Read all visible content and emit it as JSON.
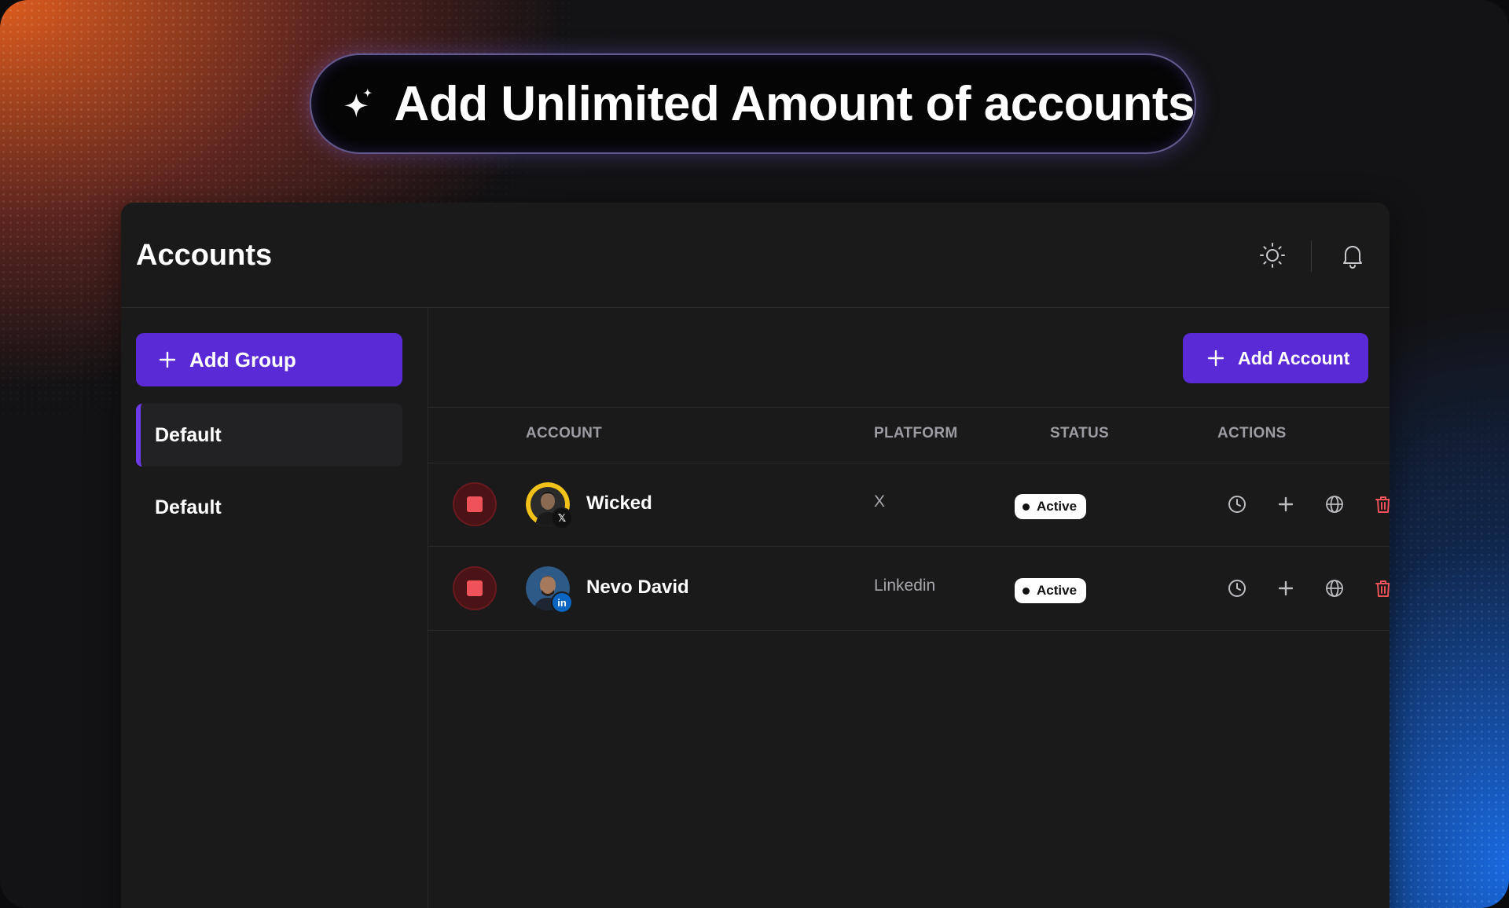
{
  "banner": {
    "title": "Add Unlimited Amount of accounts"
  },
  "header": {
    "title": "Accounts"
  },
  "sidebar": {
    "add_group_label": "Add Group",
    "groups": [
      {
        "label": "Default",
        "selected": true
      },
      {
        "label": "Default",
        "selected": false
      }
    ]
  },
  "main": {
    "add_account_label": "Add Account",
    "columns": [
      "ACCOUNT",
      "PLATFORM",
      "STATUS",
      "ACTIONS"
    ],
    "rows": [
      {
        "name": "Wicked",
        "platform": "X",
        "status": "Active",
        "badge": "x-icon"
      },
      {
        "name": "Nevo David",
        "platform": "Linkedin",
        "status": "Active",
        "badge": "linkedin-icon"
      }
    ]
  },
  "colors": {
    "accent": "#5a2ad6",
    "danger": "#f0525a",
    "panel": "#1a1a1b",
    "linkedin": "#0a66c2"
  }
}
